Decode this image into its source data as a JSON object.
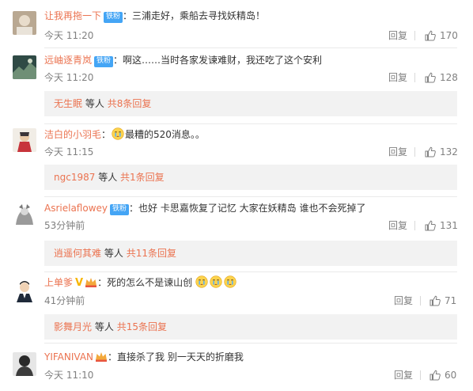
{
  "comments": [
    {
      "username": "让我再拖一下",
      "badge": "铁粉",
      "text": "：三浦走好，乘船去寻找妖精岛！",
      "time": "今天 11:20",
      "reply_label": "回复",
      "likes": "170"
    },
    {
      "username": "远岫逐青岚",
      "badge": "铁粉",
      "text": "：啊这……当时各家发谏难财，我还吃了这个安利",
      "time": "今天 11:20",
      "reply_label": "回复",
      "likes": "128",
      "sub": {
        "user": "无生眠",
        "mid": "等人",
        "count": "共8条回复"
      }
    },
    {
      "username": "洁白的小羽毛",
      "text_before": "：",
      "emoji": "crying-emoji",
      "text": "最糟的520消息。。",
      "time": "今天 11:15",
      "reply_label": "回复",
      "likes": "132",
      "sub": {
        "user": "ngc1987",
        "mid": "等人",
        "count": "共1条回复"
      }
    },
    {
      "username": "Asrielaflowey",
      "badge": "铁粉",
      "text": "：也好 卡思嘉恢复了记忆 大家在妖精岛 谁也不会死掉了",
      "time": "53分钟前",
      "reply_label": "回复",
      "likes": "131",
      "sub": {
        "user": "逍遥何其难",
        "mid": "等人",
        "count": "共11条回复"
      }
    },
    {
      "username": "上单爹",
      "badge_v": "V",
      "text": "：死的怎么不是谏山创",
      "emoji": "crying-emoji",
      "time": "41分钟前",
      "reply_label": "回复",
      "likes": "71",
      "sub": {
        "user": "影舞月光",
        "mid": "等人",
        "count": "共15条回复"
      }
    },
    {
      "username": "YIFANIVAN",
      "text": "：直接杀了我  别一天天的折磨我",
      "time": "今天 11:10",
      "reply_label": "回复",
      "likes": "60"
    }
  ],
  "colors": {
    "username": "#eb7350",
    "fan_badge": "#44a5f5",
    "meta": "#808080",
    "subbox": "#f2f2f2"
  }
}
